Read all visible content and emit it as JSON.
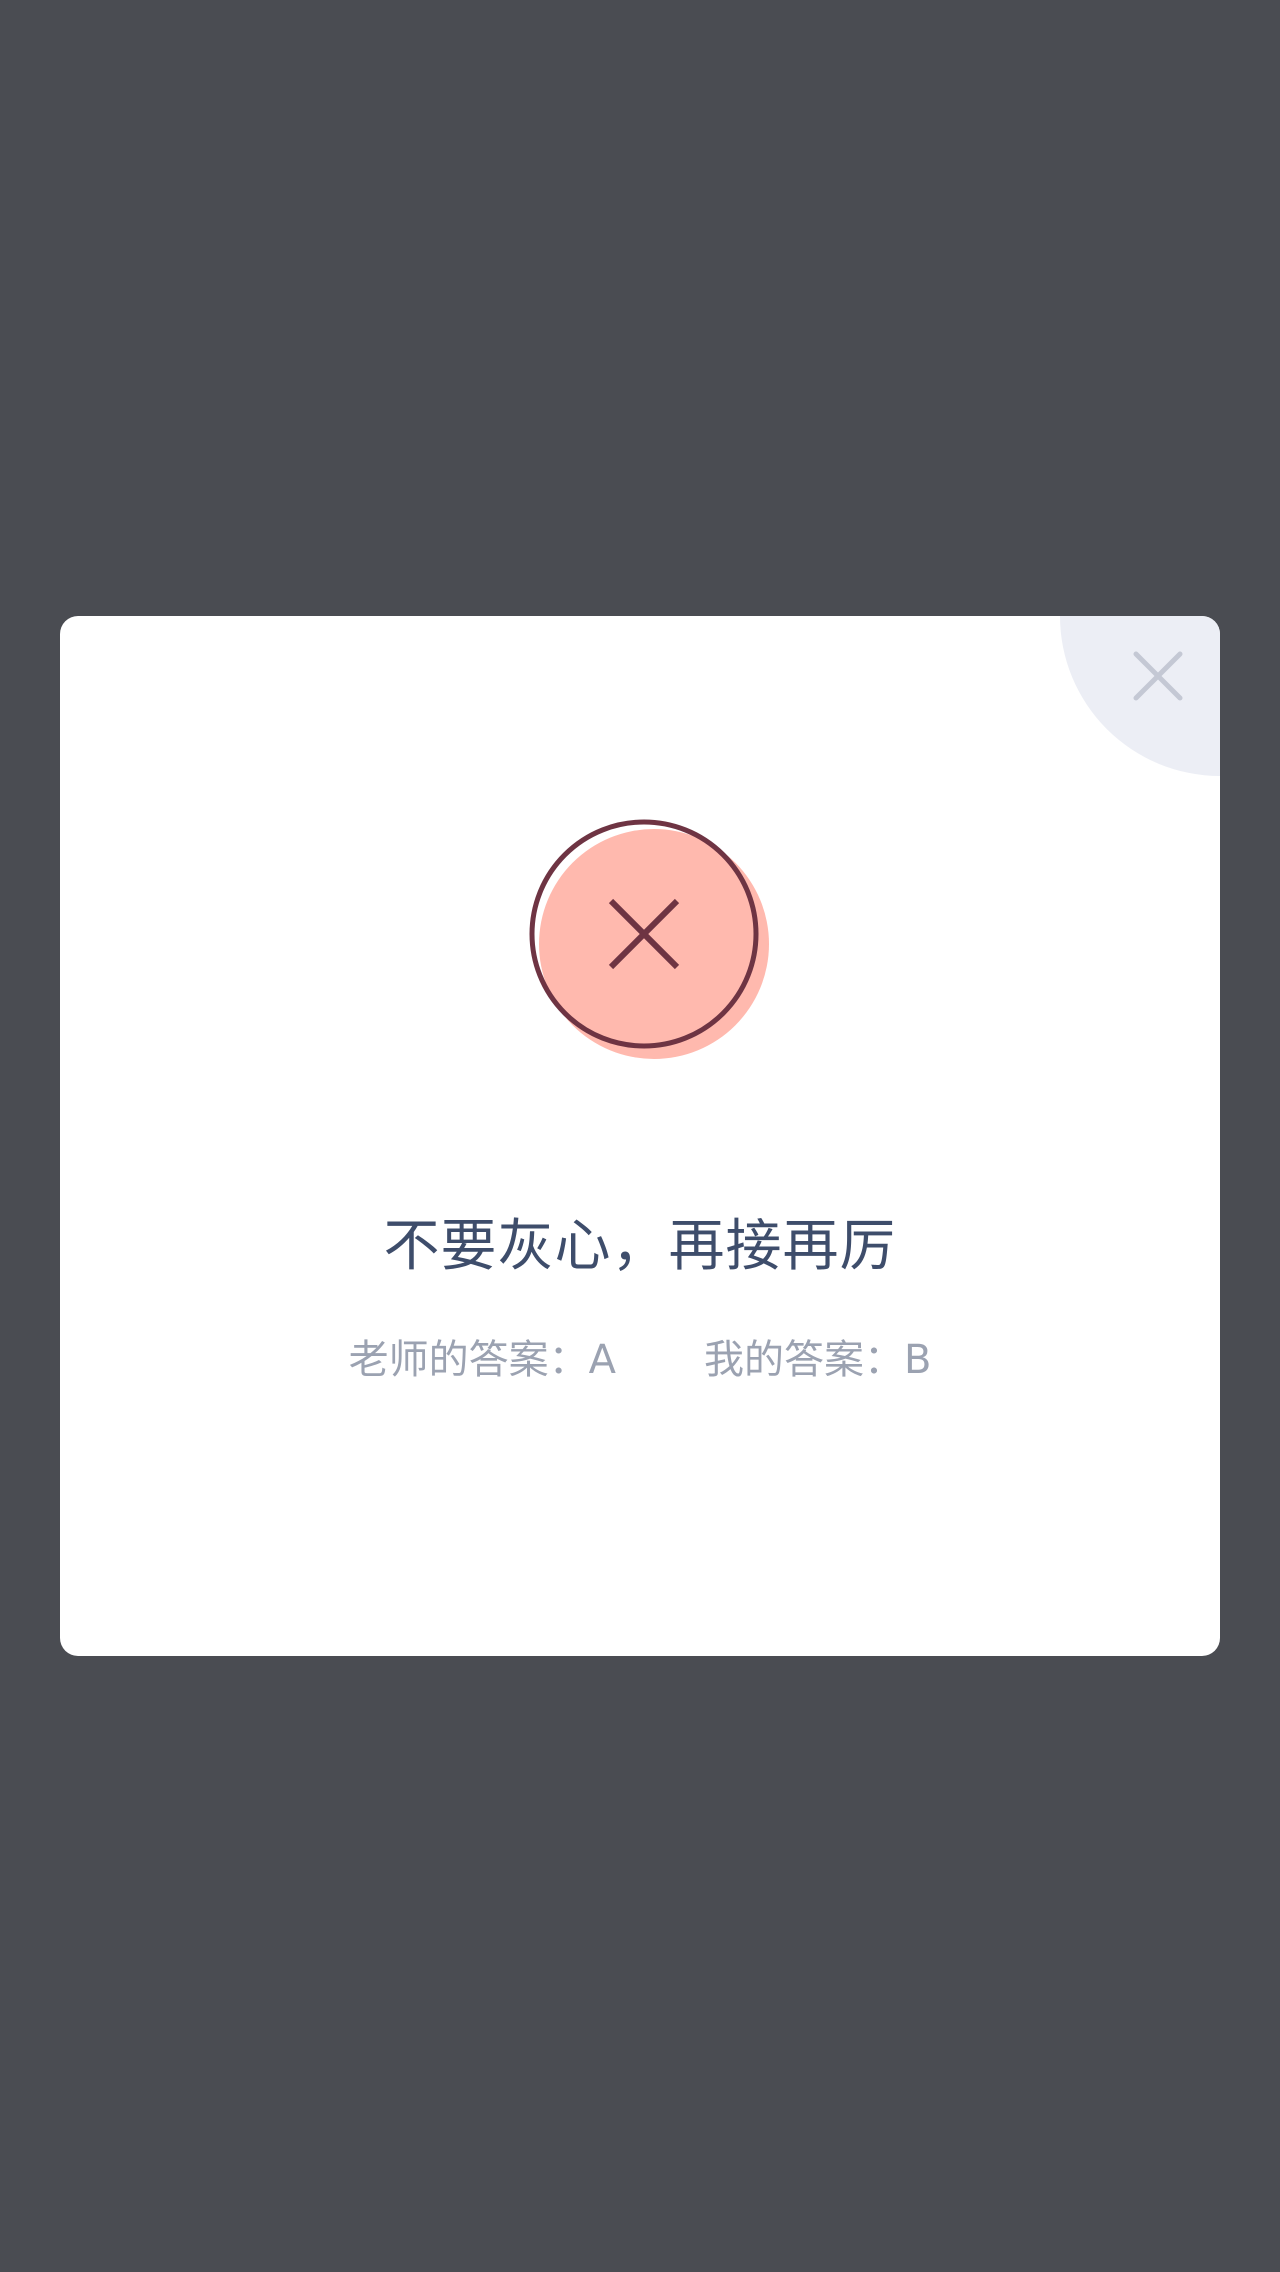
{
  "modal": {
    "title": "不要灰心，再接再厉",
    "teacher_answer": {
      "label": "老师的答案：",
      "value": "A"
    },
    "my_answer": {
      "label": "我的答案：",
      "value": "B"
    },
    "close_icon": "close-icon",
    "result_icon": "wrong-answer-icon"
  },
  "colors": {
    "overlay": "#4a4c52",
    "modal_background": "#ffffff",
    "close_corner": "#eceef5",
    "close_icon": "#c4c8d4",
    "result_fill": "#ffb9ae",
    "result_stroke": "#6e3443",
    "title_text": "#3e4d6b",
    "answer_text": "#9ba2b1"
  }
}
